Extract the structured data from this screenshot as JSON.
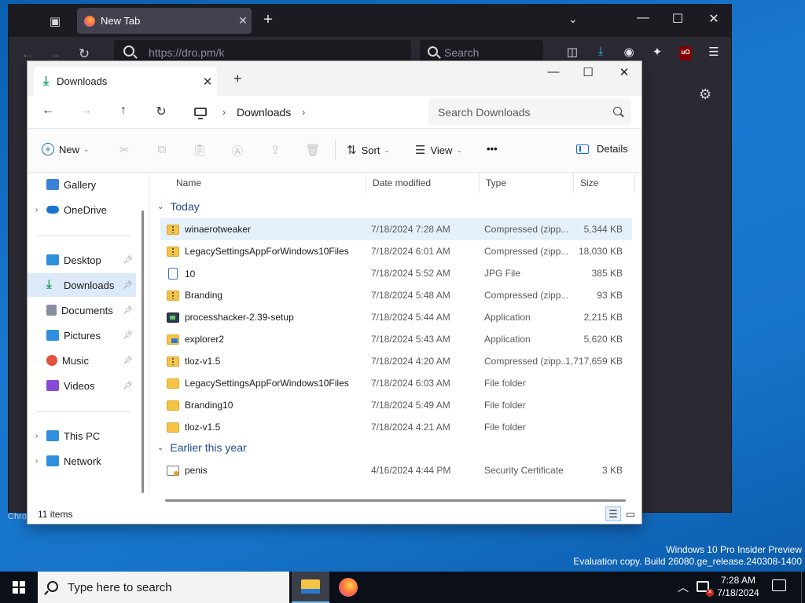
{
  "firefox": {
    "tab_title": "New Tab",
    "url": "https://dro.pm/k",
    "search_placeholder": "Search",
    "status_text": "Chro"
  },
  "explorer": {
    "tab_title": "Downloads",
    "breadcrumb": [
      "Downloads"
    ],
    "search_placeholder": "Search Downloads",
    "commands": {
      "new": "New",
      "sort": "Sort",
      "view": "View",
      "more": "•••",
      "details": "Details"
    },
    "sidebar": [
      {
        "label": "Gallery",
        "icon": "gallery-icon",
        "color": "#3b82d6"
      },
      {
        "label": "OneDrive",
        "icon": "cloud-icon",
        "color": "#1a73d1",
        "expandable": true
      },
      {
        "label": "Desktop",
        "icon": "desktop-icon",
        "color": "#2f8fdc",
        "pinned": true
      },
      {
        "label": "Downloads",
        "icon": "download-icon",
        "color": "#19a05a",
        "pinned": true,
        "selected": true
      },
      {
        "label": "Documents",
        "icon": "documents-icon",
        "color": "#8a8fa0",
        "pinned": true
      },
      {
        "label": "Pictures",
        "icon": "pictures-icon",
        "color": "#2f8fdc",
        "pinned": true
      },
      {
        "label": "Music",
        "icon": "music-icon",
        "color": "#e2543d",
        "pinned": true
      },
      {
        "label": "Videos",
        "icon": "videos-icon",
        "color": "#8a4ad6",
        "pinned": true
      },
      {
        "label": "This PC",
        "icon": "pc-icon",
        "color": "#2f8fdc",
        "expandable": true
      },
      {
        "label": "Network",
        "icon": "network-icon",
        "color": "#2f8fdc",
        "expandable": true
      }
    ],
    "columns": {
      "name": "Name",
      "date": "Date modified",
      "type": "Type",
      "size": "Size"
    },
    "groups": [
      {
        "label": "Today",
        "files": [
          {
            "name": "winaerotweaker",
            "date": "7/18/2024 7:28 AM",
            "type": "Compressed (zipp...",
            "size": "5,344 KB",
            "kind": "zip"
          },
          {
            "name": "LegacySettingsAppForWindows10Files",
            "date": "7/18/2024 6:01 AM",
            "type": "Compressed (zipp...",
            "size": "18,030 KB",
            "kind": "zip"
          },
          {
            "name": "10",
            "date": "7/18/2024 5:52 AM",
            "type": "JPG File",
            "size": "385 KB",
            "kind": "jpg"
          },
          {
            "name": "Branding",
            "date": "7/18/2024 5:48 AM",
            "type": "Compressed (zipp...",
            "size": "93 KB",
            "kind": "zip"
          },
          {
            "name": "processhacker-2.39-setup",
            "date": "7/18/2024 5:44 AM",
            "type": "Application",
            "size": "2,215 KB",
            "kind": "app"
          },
          {
            "name": "explorer2",
            "date": "7/18/2024 5:43 AM",
            "type": "Application",
            "size": "5,620 KB",
            "kind": "exp2"
          },
          {
            "name": "tloz-v1.5",
            "date": "7/18/2024 4:20 AM",
            "type": "Compressed (zipp...",
            "size": "1,717,659 KB",
            "kind": "zip"
          },
          {
            "name": "LegacySettingsAppForWindows10Files",
            "date": "7/18/2024 6:03 AM",
            "type": "File folder",
            "size": "",
            "kind": "folder"
          },
          {
            "name": "Branding10",
            "date": "7/18/2024 5:49 AM",
            "type": "File folder",
            "size": "",
            "kind": "folder"
          },
          {
            "name": "tloz-v1.5",
            "date": "7/18/2024 4:21 AM",
            "type": "File folder",
            "size": "",
            "kind": "folder"
          }
        ]
      },
      {
        "label": "Earlier this year",
        "files": [
          {
            "name": "penis",
            "date": "4/16/2024 4:44 PM",
            "type": "Security Certificate",
            "size": "3 KB",
            "kind": "cert"
          }
        ]
      }
    ],
    "status": "11 items"
  },
  "watermark": {
    "line1": "Windows 10 Pro Insider Preview",
    "line2": "Evaluation copy. Build 26080.ge_release.240308-1400"
  },
  "taskbar": {
    "search_placeholder": "Type here to search",
    "time": "7:28 AM",
    "date": "7/18/2024"
  }
}
